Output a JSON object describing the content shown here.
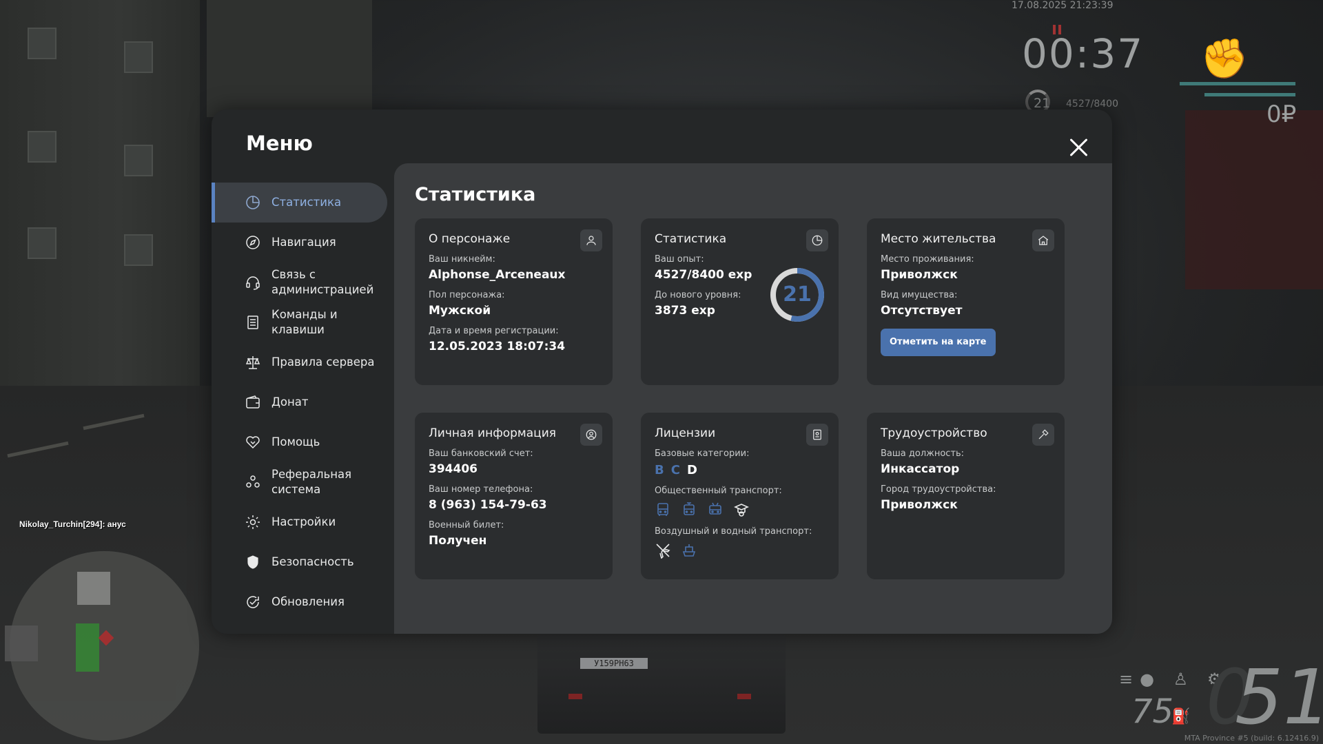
{
  "hud": {
    "datetime": "17.08.2025 21:23:39",
    "timer": "00:37",
    "level": "21",
    "exp": "4527/8400",
    "money": "0₽",
    "chat_line": "Nikolay_Turchin[294]: анус",
    "speed": "51",
    "speed_ghost": "0",
    "fuel": "75",
    "fuel_ghost": "",
    "plate": "У159РН63",
    "build": "MTA Province #5 (build: 6.12416.9)"
  },
  "menu": {
    "title": "Меню",
    "nav": [
      {
        "label": "Статистика",
        "icon": "pie-chart-icon",
        "active": true
      },
      {
        "label": "Навигация",
        "icon": "compass-icon"
      },
      {
        "label": "Связь с администрацией",
        "icon": "headset-icon"
      },
      {
        "label": "Команды и клавиши",
        "icon": "document-icon"
      },
      {
        "label": "Правила сервера",
        "icon": "scales-icon"
      },
      {
        "label": "Донат",
        "icon": "wallet-icon"
      },
      {
        "label": "Помощь",
        "icon": "heart-handshake-icon"
      },
      {
        "label": "Реферальная система",
        "icon": "people-icon"
      },
      {
        "label": "Настройки",
        "icon": "gear-icon"
      },
      {
        "label": "Безопасность",
        "icon": "shield-icon"
      },
      {
        "label": "Обновления",
        "icon": "refresh-check-icon"
      }
    ]
  },
  "content": {
    "title": "Статистика",
    "character": {
      "title": "О персонаже",
      "nickname_label": "Ваш никнейм:",
      "nickname": "Alphonse_Arceneaux",
      "gender_label": "Пол персонажа:",
      "gender": "Мужской",
      "reg_label": "Дата и время регистрации:",
      "reg_date": "12.05.2023 18:07:34"
    },
    "stats": {
      "title": "Статистика",
      "exp_label": "Ваш опыт:",
      "exp": "4527/8400 exp",
      "next_label": "До нового уровня:",
      "next": "3873 exp",
      "level": "21",
      "progress": 0.539
    },
    "residence": {
      "title": "Место жительства",
      "place_label": "Место проживания:",
      "place": "Приволжск",
      "property_label": "Вид имущества:",
      "property": "Отсутствует",
      "map_button": "Отметить на карте"
    },
    "personal": {
      "title": "Личная информация",
      "bank_label": "Ваш банковский счет:",
      "bank": "394406",
      "phone_label": "Ваш номер телефона:",
      "phone": "8 (963) 154-79-63",
      "military_label": "Военный билет:",
      "military": "Получен"
    },
    "licenses": {
      "title": "Лицензии",
      "base_label": "Базовые категории:",
      "categories": [
        {
          "name": "B",
          "color": "#4a72ad"
        },
        {
          "name": "C",
          "color": "#4a72ad"
        },
        {
          "name": "D",
          "color": "#ffffff"
        }
      ],
      "public_label": "Общественный транспорт:",
      "air_label": "Воздушный и водный транспорт:"
    },
    "job": {
      "title": "Трудоустройство",
      "position_label": "Ваша должность:",
      "position": "Инкассатор",
      "city_label": "Город трудоустройства:",
      "city": "Приволжск"
    }
  },
  "colors": {
    "accent": "#4a72ad",
    "panel": "#2b2d2f",
    "window": "#252728"
  }
}
